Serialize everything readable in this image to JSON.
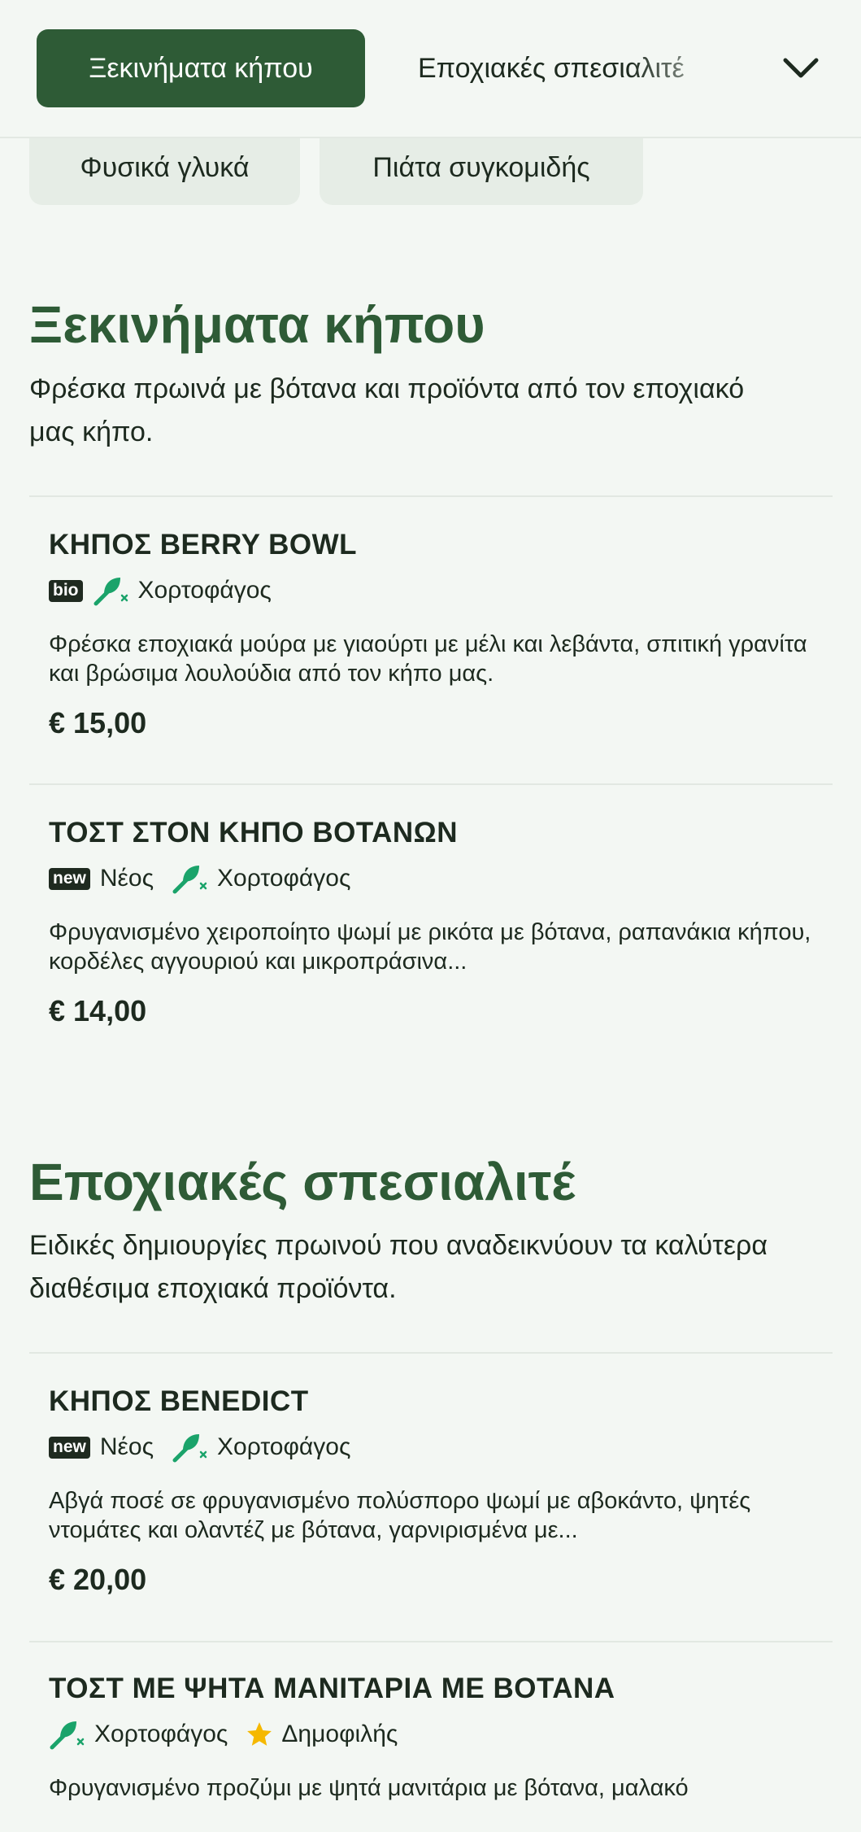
{
  "header": {
    "active_category": "Ξεκινήματα κήπου",
    "next_category": "Εποχιακές σπεσιαλιτέ",
    "dropdown_icon": "chevron-down-icon"
  },
  "chips": [
    "Φυσικά γλυκά",
    "Πιάτα συγκομιδής"
  ],
  "colors": {
    "brand": "#2e5b36",
    "background": "#f3f7f3",
    "leaf_icon": "#1aa36a",
    "star": "#f5b800"
  },
  "sections": [
    {
      "title": "Ξεκινήματα κήπου",
      "description": "Φρέσκα πρωινά με βότανα και προϊόντα από τον εποχιακό μας κήπο.",
      "items": [
        {
          "name": "ΚΗΠΟΣ BERRY BOWL",
          "badge": "bio",
          "tags": [
            "Χορτοφάγος"
          ],
          "description": "Φρέσκα εποχιακά μούρα με γιαούρτι με μέλι και λεβάντα, σπιτική γρανίτα και βρώσιμα λουλούδια από τον κήπο μας.",
          "price": "€ 15,00"
        },
        {
          "name": "ΤΟΣΤ ΣΤΟΝ ΚΗΠΟ ΒΟΤΑΝΩΝ",
          "badge": "new",
          "new_label": "Νέος",
          "tags": [
            "Χορτοφάγος"
          ],
          "description": "Φρυγανισμένο χειροποίητο ψωμί με ρικότα με βότανα, ραπανάκια κήπου, κορδέλες αγγουριού και μικροπράσινα...",
          "price": "€ 14,00"
        }
      ]
    },
    {
      "title": "Εποχιακές σπεσιαλιτέ",
      "description": "Ειδικές δημιουργίες πρωινού που αναδεικνύουν τα καλύτερα διαθέσιμα εποχιακά προϊόντα.",
      "items": [
        {
          "name": "ΚΗΠΟΣ BENEDICT",
          "badge": "new",
          "new_label": "Νέος",
          "tags": [
            "Χορτοφάγος"
          ],
          "description": "Αβγά ποσέ σε φρυγανισμένο πολύσπορο ψωμί με αβοκάντο, ψητές ντομάτες και ολαντέζ με βότανα, γαρνιρισμένα με...",
          "price": "€ 20,00"
        },
        {
          "name": "ΤΟΣΤ ΜΕ ΨΗΤΑ ΜΑΝΙΤΑΡΙΑ ΜΕ ΒΟΤΑΝΑ",
          "tags": [
            "Χορτοφάγος",
            "Δημοφιλής"
          ],
          "description": "Φρυγανισμένο προζύμι με ψητά μανιτάρια με βότανα, μαλακό"
        }
      ]
    }
  ]
}
